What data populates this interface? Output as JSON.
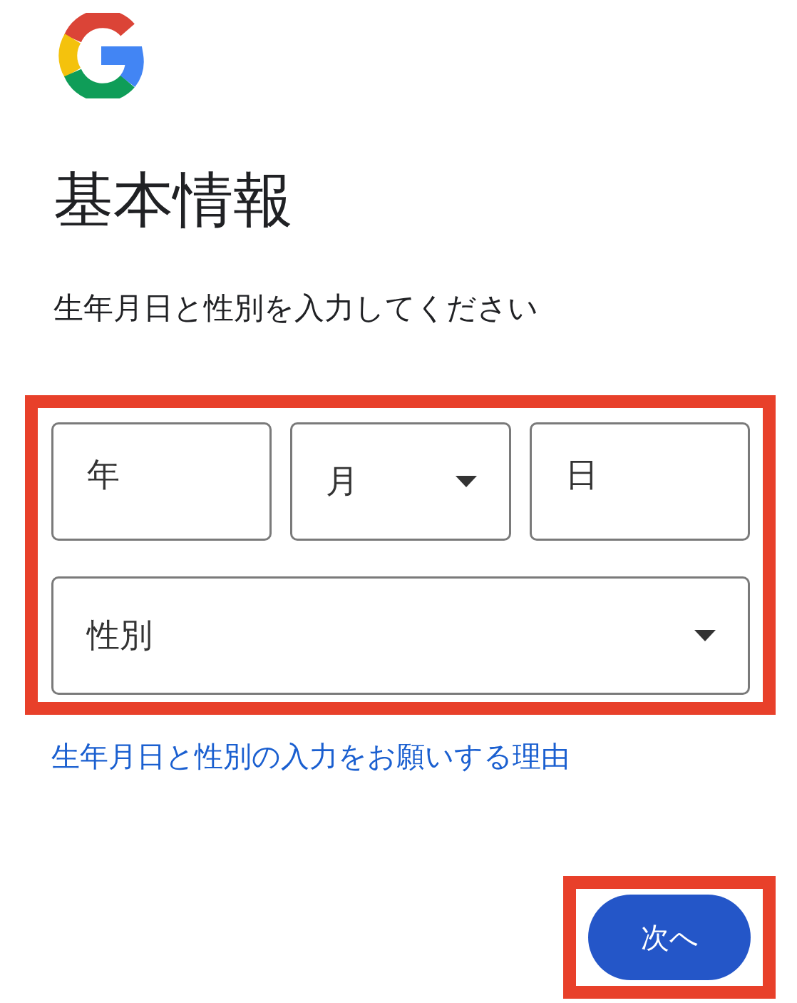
{
  "title": "基本情報",
  "subtitle": "生年月日と性別を入力してください",
  "fields": [
    {
      "kind": "text",
      "label": "年"
    },
    {
      "kind": "select",
      "label": "月"
    },
    {
      "kind": "text",
      "label": "日"
    },
    {
      "kind": "select",
      "label": "性別"
    }
  ],
  "link": "生年月日と性別の入力をお願いする理由",
  "button": "次へ"
}
